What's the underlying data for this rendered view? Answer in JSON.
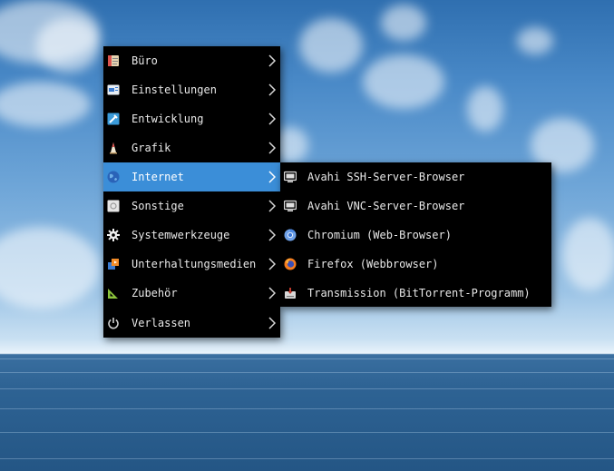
{
  "main_menu": {
    "items": [
      {
        "label": "Büro",
        "icon": "office-icon"
      },
      {
        "label": "Einstellungen",
        "icon": "settings-panel-icon"
      },
      {
        "label": "Entwicklung",
        "icon": "development-icon"
      },
      {
        "label": "Grafik",
        "icon": "graphics-icon"
      },
      {
        "label": "Internet",
        "icon": "globe-icon"
      },
      {
        "label": "Sonstige",
        "icon": "other-icon"
      },
      {
        "label": "Systemwerkzeuge",
        "icon": "gear-icon"
      },
      {
        "label": "Unterhaltungsmedien",
        "icon": "multimedia-icon"
      },
      {
        "label": "Zubehör",
        "icon": "accessories-icon"
      },
      {
        "label": "Verlassen",
        "icon": "power-icon"
      }
    ],
    "active_index": 4
  },
  "internet_submenu": {
    "items": [
      {
        "label": "Avahi SSH-Server-Browser",
        "icon": "monitor-icon"
      },
      {
        "label": "Avahi VNC-Server-Browser",
        "icon": "monitor-icon"
      },
      {
        "label": "Chromium (Web-Browser)",
        "icon": "chromium-icon"
      },
      {
        "label": "Firefox (Webbrowser)",
        "icon": "firefox-icon"
      },
      {
        "label": "Transmission (BitTorrent-Programm)",
        "icon": "transmission-icon"
      }
    ]
  },
  "colors": {
    "menu_background": "#000000",
    "highlight": "#3b8ed8",
    "text": "#e8e8e8"
  }
}
